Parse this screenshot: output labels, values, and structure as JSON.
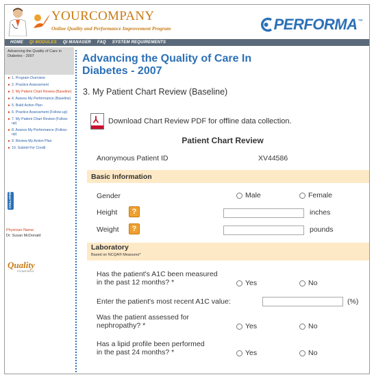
{
  "header": {
    "company_name": "YOURCOMPANY",
    "company_tagline": "Online Quality and Performance Improvement Program",
    "brand": "PERFORMA",
    "brand_tm": "™",
    "brand_color": "#2b70b7",
    "accent_color": "#c77a12"
  },
  "nav": {
    "items": [
      {
        "label": "HOME",
        "active": false
      },
      {
        "label": "QI MODULES",
        "active": true
      },
      {
        "label": "QI MANAGER",
        "active": false
      },
      {
        "label": "FAQ",
        "active": false
      },
      {
        "label": "SYSTEM REQUIREMENTS",
        "active": false
      }
    ]
  },
  "sidebar": {
    "heading": "Advancing the Quality of Care in Diabetes - 2007",
    "items": [
      {
        "label": "1. Program Overview",
        "current": false
      },
      {
        "label": "2. Practice Assessment",
        "current": false
      },
      {
        "label": "3. My Patient Chart Review (Baseline)",
        "current": true
      },
      {
        "label": "4. Assess My Performance (Baseline)",
        "current": false
      },
      {
        "label": "5. Build Action Plan",
        "current": false
      },
      {
        "label": "6. Practice Assessment (Follow-up)",
        "current": false
      },
      {
        "label": "7. My Patient Chart Review (Follow-up)",
        "current": false
      },
      {
        "label": "8. Assess My Performance (Follow-up)",
        "current": false
      },
      {
        "label": "9. Review My Action Plan",
        "current": false
      },
      {
        "label": "10. Submit For Credit",
        "current": false
      }
    ],
    "collapse_label": "COLLAPSE",
    "physician_label": "Physician Name:",
    "physician_name": "Dr. Susan McDonald",
    "quality_logo": "Quality",
    "quality_logo_sub": "POWERED"
  },
  "main": {
    "page_title": "Advancing the Quality of Care In Diabetes - 2007",
    "section_title": "3. My Patient Chart Review (Baseline)",
    "pdf_link": "Download Chart Review PDF for offline data collection.",
    "form_title": "Patient Chart Review",
    "patient_id_label": "Anonymous Patient ID",
    "patient_id_value": "XV44586",
    "basic_info": {
      "title": "Basic Information",
      "gender_label": "Gender",
      "gender_options": [
        "Male",
        "Female"
      ],
      "height_label": "Height",
      "height_unit": "inches",
      "weight_label": "Weight",
      "weight_unit": "pounds",
      "help_glyph": "?"
    },
    "laboratory": {
      "title": "Laboratory",
      "subtitle": "Based on NCQA® Measures*",
      "q1_line1": "Has the patient's A1C been measured",
      "q1_line2": "in the past 12 months? *",
      "q2": "Enter the patient's most recent A1C value:",
      "q2_unit": "(%)",
      "q3_line1": "Was the patient assessed for",
      "q3_line2": "nephropathy? *",
      "q4_line1": "Has a lipid profile been performed",
      "q4_line2": "in the past 24 months? *",
      "yes": "Yes",
      "no": "No"
    }
  }
}
